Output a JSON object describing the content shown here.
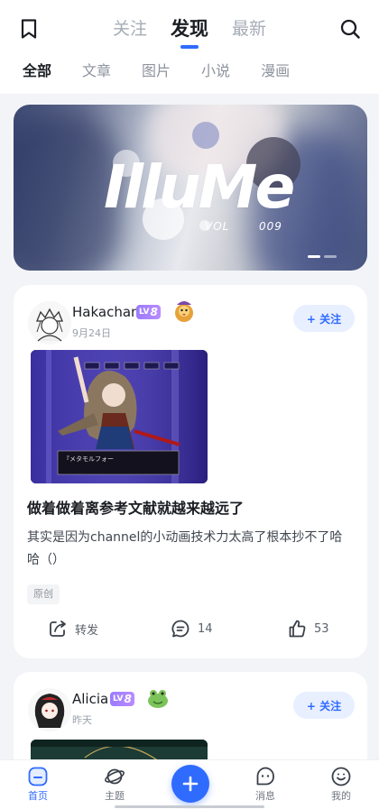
{
  "header": {
    "tabs": [
      {
        "label": "关注",
        "active": false
      },
      {
        "label": "发现",
        "active": true
      },
      {
        "label": "最新",
        "active": false
      }
    ],
    "icons": {
      "left": "bookmark-icon",
      "right": "search-icon"
    }
  },
  "sub_tabs": [
    {
      "label": "全部",
      "active": true
    },
    {
      "label": "文章",
      "active": false
    },
    {
      "label": "图片",
      "active": false
    },
    {
      "label": "小说",
      "active": false
    },
    {
      "label": "漫画",
      "active": false
    }
  ],
  "banner": {
    "title": "IlluMe",
    "vol_label": "VOL",
    "vol_number": "009",
    "slide_count": 2,
    "active_slide": 0
  },
  "posts": [
    {
      "username": "Hakachan",
      "level": "8",
      "level_prefix": "LV",
      "date": "9月24日",
      "follow_label": "+ 关注",
      "title": "做着做着离参考文献就越来越远了",
      "body": "其实是因为channel的小动画技术力太高了根本抄不了哈哈（）",
      "tag": "原创",
      "image_caption": "『メタモルフォー",
      "actions": {
        "share": "转发",
        "comments": "14",
        "likes": "53"
      }
    },
    {
      "username": "Alicia",
      "level": "8",
      "level_prefix": "LV",
      "date": "昨天",
      "follow_label": "+ 关注"
    }
  ],
  "bottom_nav": [
    {
      "label": "首页",
      "icon": "home-icon",
      "active": true
    },
    {
      "label": "主题",
      "icon": "planet-icon",
      "active": false
    },
    {
      "label": "",
      "icon": "plus-icon",
      "active": false
    },
    {
      "label": "消息",
      "icon": "message-icon",
      "active": false
    },
    {
      "label": "我的",
      "icon": "smile-icon",
      "active": false
    }
  ],
  "colors": {
    "accent": "#2f6bff",
    "level_badge": "#a27fff",
    "background": "#f2f4f7"
  }
}
